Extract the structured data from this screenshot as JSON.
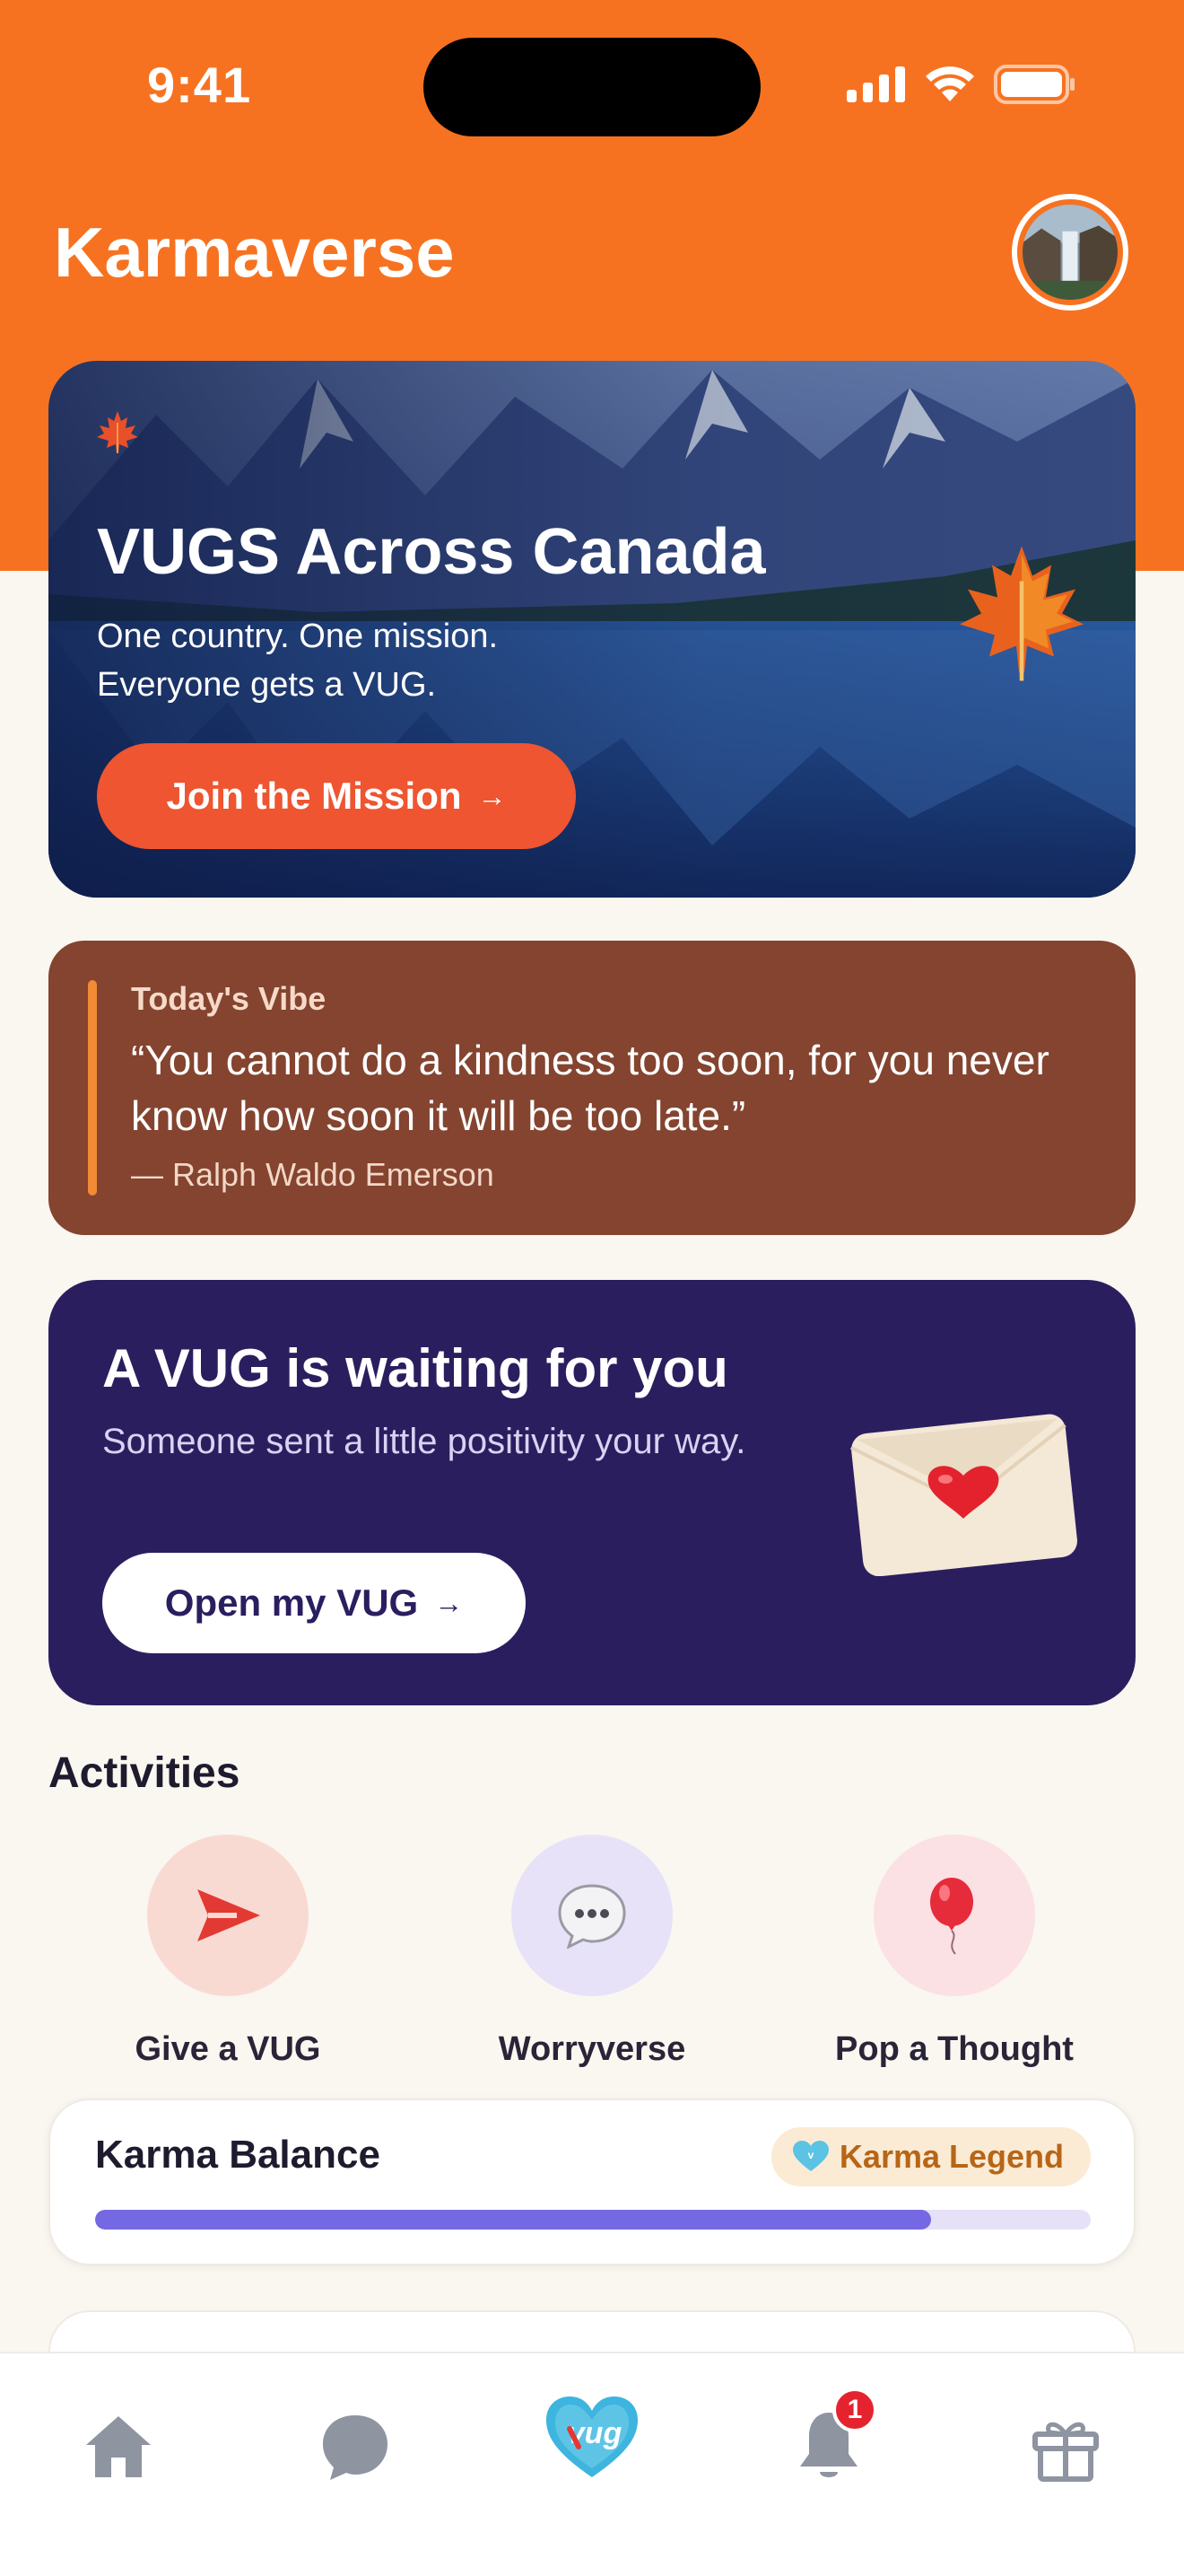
{
  "status_bar": {
    "time": "9:41"
  },
  "header": {
    "title": "Karmaverse"
  },
  "hero": {
    "title": "VUGS Across Canada",
    "subtitle_line1": "One country. One mission.",
    "subtitle_line2": "Everyone gets a VUG.",
    "button_label": "Join the Mission",
    "button_arrow": "→"
  },
  "vibe": {
    "label": "Today's Vibe",
    "quote": "“You cannot do a kindness too soon, for you never know how soon it will be too late.”",
    "author": "— Ralph Waldo Emerson"
  },
  "vug_waiting": {
    "title": "A VUG is waiting for you",
    "subtitle": "Someone sent a little positivity your way.",
    "button_label": "Open my VUG",
    "button_arrow": "→"
  },
  "activities": {
    "title": "Activities",
    "items": [
      {
        "label": "Give a VUG",
        "icon": "send-icon"
      },
      {
        "label": "Worryverse",
        "icon": "speech-bubble-icon"
      },
      {
        "label": "Pop a Thought",
        "icon": "balloon-icon"
      }
    ]
  },
  "karma": {
    "title": "Karma Balance",
    "badge": "Karma Legend",
    "progress": 0.84
  },
  "tabbar": {
    "items": [
      "home-icon",
      "chat-icon",
      "vug-logo-icon",
      "bell-icon",
      "gift-icon"
    ],
    "notification_count": "1",
    "logo_text": "vug"
  }
}
